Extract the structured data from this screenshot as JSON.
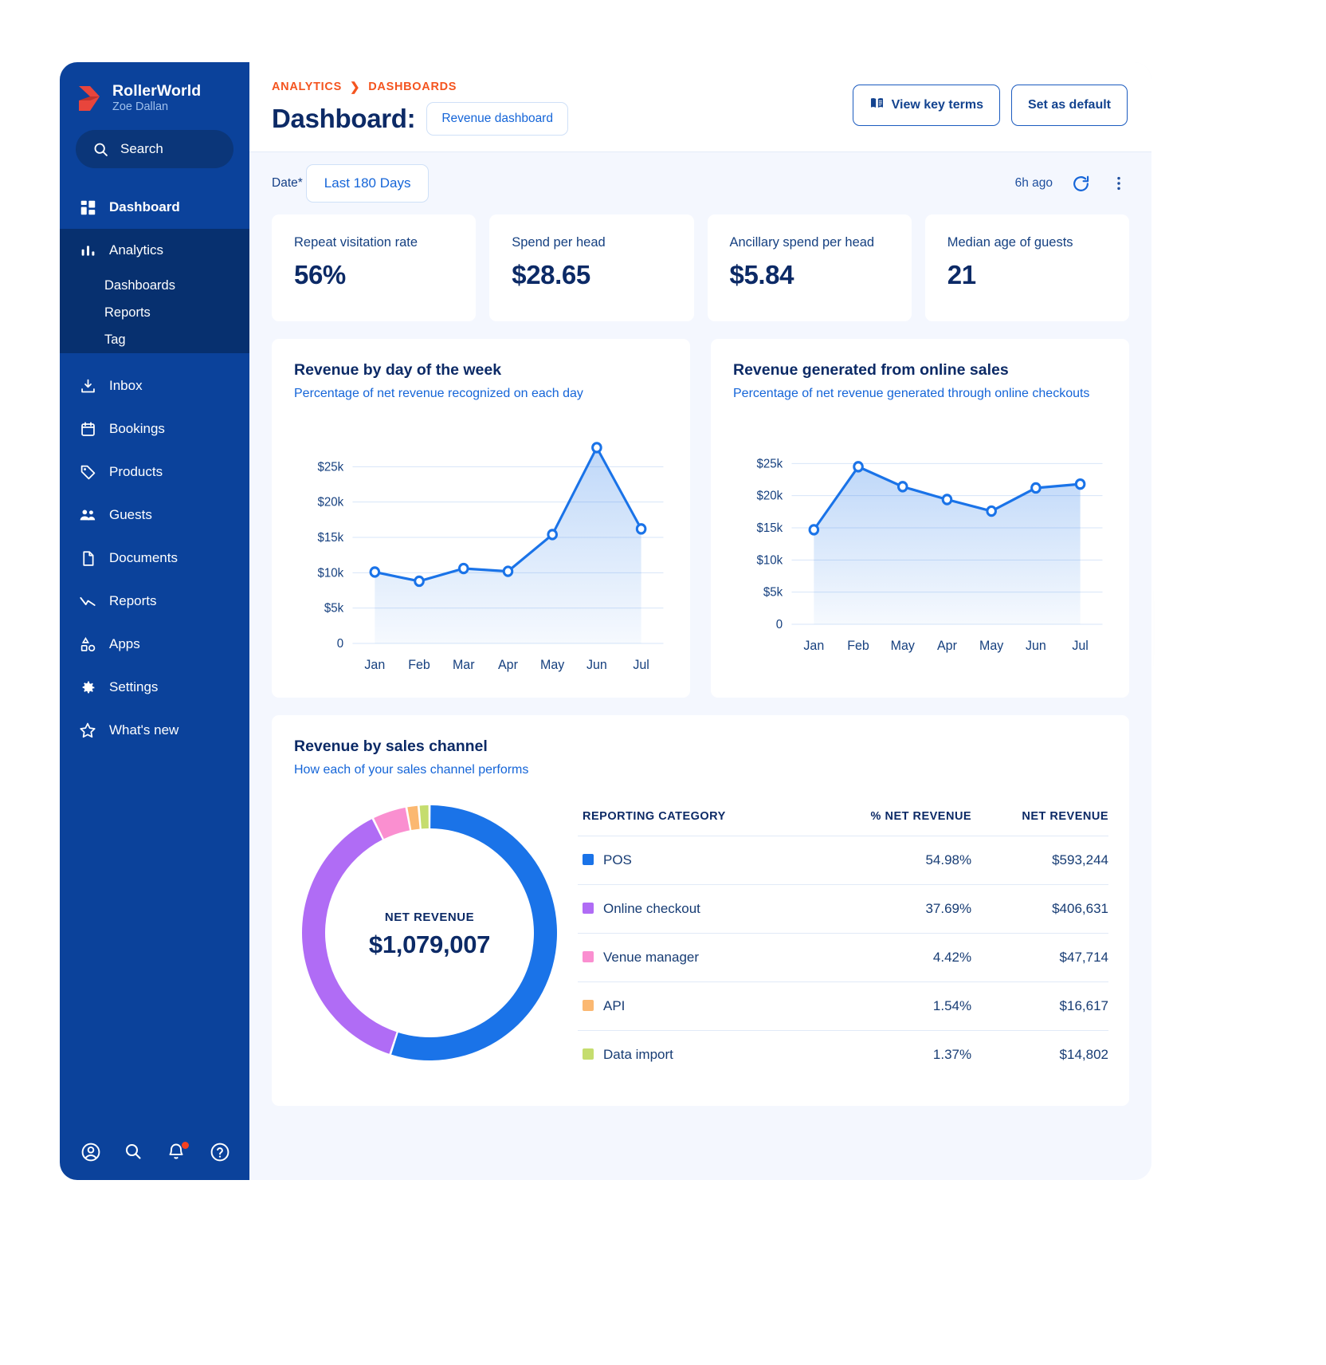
{
  "sidebar": {
    "brand": {
      "name": "RollerWorld",
      "user": "Zoe Dallan",
      "logo_icon": "rollerworld-logo"
    },
    "search": {
      "label": "Search",
      "icon": "search-icon"
    },
    "items": [
      {
        "label": "Dashboard",
        "icon": "dashboard-grid-icon",
        "active": true
      },
      {
        "label": "Analytics",
        "icon": "bar-chart-icon",
        "active": false
      },
      {
        "label": "Inbox",
        "icon": "inbox-download-icon",
        "active": false
      },
      {
        "label": "Bookings",
        "icon": "calendar-icon",
        "active": false
      },
      {
        "label": "Products",
        "icon": "tag-icon",
        "active": false
      },
      {
        "label": "Guests",
        "icon": "people-icon",
        "active": false
      },
      {
        "label": "Documents",
        "icon": "document-icon",
        "active": false
      },
      {
        "label": "Reports",
        "icon": "trend-line-icon",
        "active": false
      },
      {
        "label": "Apps",
        "icon": "apps-shapes-icon",
        "active": false
      },
      {
        "label": "Settings",
        "icon": "gear-icon",
        "active": false
      },
      {
        "label": "What's new",
        "icon": "star-icon",
        "active": false
      }
    ],
    "analytics_sub": [
      "Dashboards",
      "Reports",
      "Tag"
    ],
    "bottom_icons": [
      "account-circle-icon",
      "search-icon",
      "notifications-bell-icon",
      "help-circle-icon"
    ]
  },
  "header": {
    "breadcrumb": [
      "ANALYTICS",
      "DASHBOARDS"
    ],
    "title": "Dashboard:",
    "dashboard_select": "Revenue dashboard",
    "view_key_terms": "View key terms",
    "view_key_terms_icon": "book-icon",
    "set_as_default": "Set as default"
  },
  "filters": {
    "date_label": "Date*",
    "date_value": "Last 180 Days",
    "last_updated": "6h ago",
    "refresh_icon": "refresh-icon",
    "more_icon": "more-vertical-icon"
  },
  "kpis": [
    {
      "label": "Repeat visitation rate",
      "value": "56%"
    },
    {
      "label": "Spend per head",
      "value": "$28.65"
    },
    {
      "label": "Ancillary spend per head",
      "value": "$5.84"
    },
    {
      "label": "Median age of guests",
      "value": "21"
    }
  ],
  "colors": {
    "accent_blue": "#1a73e8",
    "brand_navy": "#0b429b",
    "breadcrumb_orange": "#f4541f",
    "pos": "#1a73e8",
    "online_checkout": "#b06cf5",
    "venue_manager": "#fa8fd0",
    "api": "#fbb871",
    "data_import": "#c5dd6e"
  },
  "chart_data": [
    {
      "type": "area",
      "title": "Revenue by day of the week",
      "subtitle": "Percentage of net revenue recognized on each day",
      "categories": [
        "Jan",
        "Feb",
        "Mar",
        "Apr",
        "May",
        "Jun",
        "Jul"
      ],
      "values": [
        10100,
        8800,
        10600,
        10200,
        15400,
        27700,
        16200
      ],
      "xlabel": "",
      "ylabel": "",
      "ylim": [
        0,
        30000
      ],
      "yticks": [
        0,
        5000,
        10000,
        15000,
        20000,
        25000
      ],
      "yticklabels": [
        "0",
        "$5k",
        "$10k",
        "$15k",
        "$20k",
        "$25k"
      ],
      "grid": true,
      "legend": "none"
    },
    {
      "type": "area",
      "title": "Revenue generated from online sales",
      "subtitle": "Percentage of net revenue generated through online checkouts",
      "categories": [
        "Jan",
        "Feb",
        "May",
        "Apr",
        "May",
        "Jun",
        "Jul"
      ],
      "values": [
        14700,
        24500,
        21400,
        19400,
        17600,
        21200,
        21800
      ],
      "xlabel": "",
      "ylabel": "",
      "ylim": [
        0,
        30000
      ],
      "yticks": [
        0,
        5000,
        10000,
        15000,
        20000,
        25000
      ],
      "yticklabels": [
        "0",
        "$5k",
        "$10k",
        "$15k",
        "$20k",
        "$25k"
      ],
      "grid": true,
      "legend": "none"
    },
    {
      "type": "pie",
      "title": "Revenue by sales channel",
      "subtitle": "How each of your sales channel performs",
      "center_caption": "NET REVENUE",
      "center_value": "$1,079,007",
      "labels": [
        "POS",
        "Online checkout",
        "Venue manager",
        "API",
        "Data import"
      ],
      "values": [
        54.98,
        37.69,
        4.42,
        1.54,
        1.37
      ],
      "amounts": [
        "$593,244",
        "$406,631",
        "$47,714",
        "$16,617",
        "$14,802"
      ],
      "colors": [
        "#1a73e8",
        "#b06cf5",
        "#fa8fd0",
        "#fbb871",
        "#c5dd6e"
      ]
    }
  ],
  "channel_table": {
    "headers": [
      "REPORTING CATEGORY",
      "% NET REVENUE",
      "NET REVENUE"
    ],
    "rows": [
      {
        "category": "POS",
        "percent": "54.98%",
        "amount": "$593,244",
        "color": "#1a73e8"
      },
      {
        "category": "Online checkout",
        "percent": "37.69%",
        "amount": "$406,631",
        "color": "#b06cf5"
      },
      {
        "category": "Venue manager",
        "percent": "4.42%",
        "amount": "$47,714",
        "color": "#fa8fd0"
      },
      {
        "category": "API",
        "percent": "1.54%",
        "amount": "$16,617",
        "color": "#fbb871"
      },
      {
        "category": "Data import",
        "percent": "1.37%",
        "amount": "$14,802",
        "color": "#c5dd6e"
      }
    ]
  }
}
